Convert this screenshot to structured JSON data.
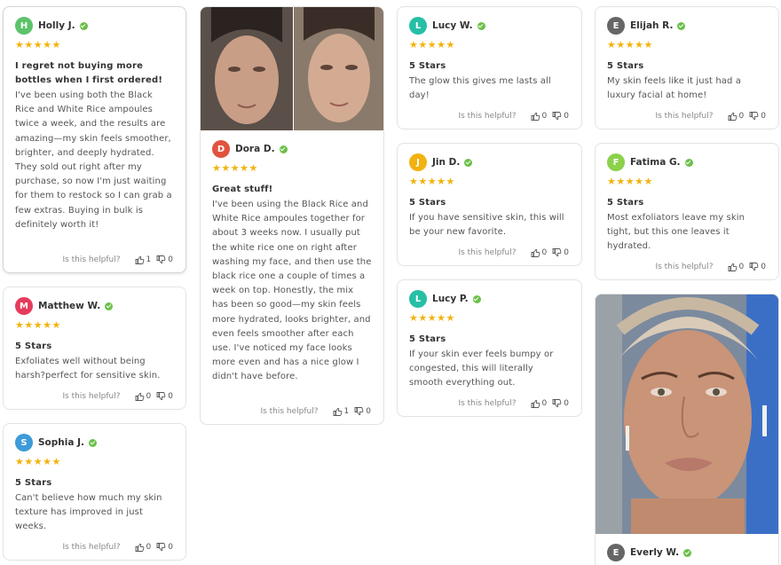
{
  "colors": {
    "star": "#f3b30d",
    "verified": "#6cc04a"
  },
  "helpful_prompt": "Is this helpful?",
  "reviews": {
    "holly": {
      "initial": "H",
      "avatar_color": "#5cc36a",
      "name": "Holly J.",
      "stars": "★★★★★",
      "title": "I regret not buying more bottles when I first ordered!",
      "body": "I've been using both the Black Rice and White Rice ampoules twice a week, and the results are amazing—my skin feels smoother, brighter, and deeply hydrated. They sold out right after my purchase, so now I'm just waiting for them to restock so I can grab a few extras. Buying in bulk is definitely worth it!",
      "up": "1",
      "down": "0"
    },
    "matthew": {
      "initial": "M",
      "avatar_color": "#e63b5d",
      "name": "Matthew W.",
      "stars": "★★★★★",
      "title": "5 Stars",
      "body": "Exfoliates well without being harsh?perfect for sensitive skin.",
      "up": "0",
      "down": "0"
    },
    "sophia": {
      "initial": "S",
      "avatar_color": "#3d9bd8",
      "name": "Sophia J.",
      "stars": "★★★★★",
      "title": "5 Stars",
      "body": "Can't believe how much my skin texture has improved in just weeks.",
      "up": "0",
      "down": "0"
    },
    "dora": {
      "initial": "D",
      "avatar_color": "#e0533f",
      "name": "Dora D.",
      "stars": "★★★★★",
      "title": "Great stuff!",
      "body": "I've been using the Black Rice and White Rice ampoules together for about 3 weeks now. I usually put the white rice one on right after washing my face, and then use the black rice one a couple of times a week on top. Honestly, the mix has been so good—my skin feels more hydrated, looks brighter, and even feels smoother after each use. I've noticed my face looks more even and has a nice glow I didn't have before.",
      "up": "1",
      "down": "0"
    },
    "lucy_w": {
      "initial": "L",
      "avatar_color": "#26bfa6",
      "name": "Lucy W.",
      "stars": "★★★★★",
      "title": "5 Stars",
      "body": "The glow this gives me lasts all day!",
      "up": "0",
      "down": "0"
    },
    "jin": {
      "initial": "J",
      "avatar_color": "#f2b20f",
      "name": "Jin D.",
      "stars": "★★★★★",
      "title": "5 Stars",
      "body": "If you have sensitive skin, this will be your new favorite.",
      "up": "0",
      "down": "0"
    },
    "lucy_p": {
      "initial": "L",
      "avatar_color": "#26bfa6",
      "name": "Lucy P.",
      "stars": "★★★★★",
      "title": "5 Stars",
      "body": "If your skin ever feels bumpy or congested, this will literally smooth everything out.",
      "up": "0",
      "down": "0"
    },
    "elijah": {
      "initial": "E",
      "avatar_color": "#666666",
      "name": "Elijah R.",
      "stars": "★★★★★",
      "title": "5 Stars",
      "body": "My skin feels like it just had a luxury facial at home!",
      "up": "0",
      "down": "0"
    },
    "fatima": {
      "initial": "F",
      "avatar_color": "#8bd14a",
      "name": "Fatima G.",
      "stars": "★★★★★",
      "title": "5 Stars",
      "body": "Most exfoliators leave my skin tight, but this one leaves it hydrated.",
      "up": "0",
      "down": "0"
    },
    "everly": {
      "initial": "E",
      "avatar_color": "#666666",
      "name": "Everly W."
    }
  }
}
